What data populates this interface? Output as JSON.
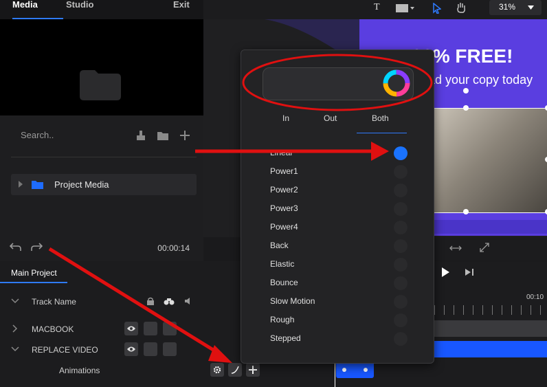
{
  "tabs": {
    "media": "Media",
    "studio": "Studio",
    "exit": "Exit"
  },
  "search": {
    "placeholder": "Search.."
  },
  "media": {
    "project_folder": "Project Media"
  },
  "timecode": "00:00:14",
  "timeline": {
    "tab": "Main Project",
    "track_name": "Track Name",
    "tracks": [
      "MACBOOK",
      "REPLACE VIDEO"
    ],
    "animations": "Animations",
    "ruler_time": "00:10"
  },
  "toolbar": {
    "zoom": "31%"
  },
  "canvas": {
    "headline": "100% FREE!",
    "sub": "ad your copy today"
  },
  "easing": {
    "tabs": [
      "In",
      "Out",
      "Both"
    ],
    "selected_tab": "Both",
    "options": [
      "Linear",
      "Power1",
      "Power2",
      "Power3",
      "Power4",
      "Back",
      "Elastic",
      "Bounce",
      "Slow Motion",
      "Rough",
      "Stepped"
    ],
    "selected": "Linear"
  },
  "colors": {
    "accent": "#2f7bff",
    "annotation": "#e01010",
    "promo": "#5a3ee0"
  }
}
